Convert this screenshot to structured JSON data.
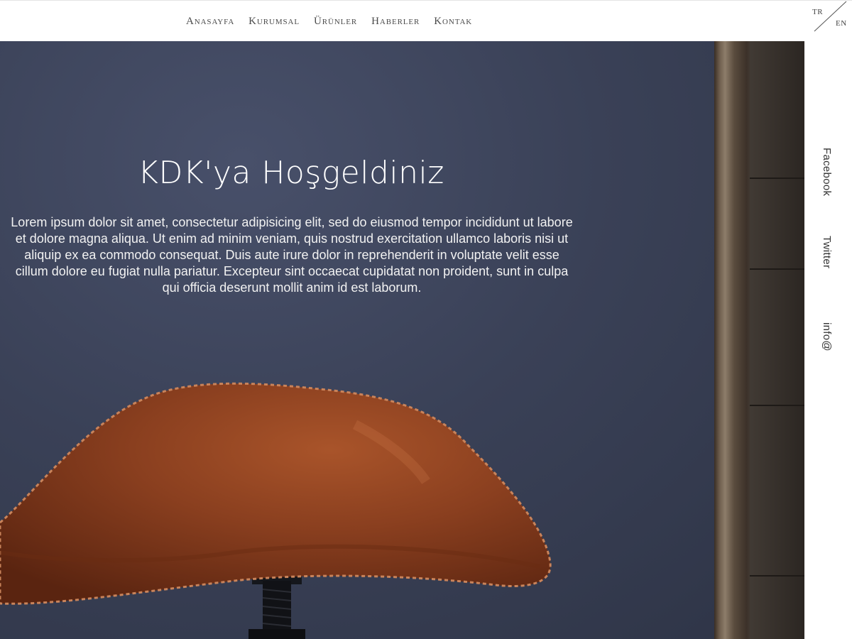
{
  "nav": {
    "items": [
      "Anasayfa",
      "Kurumsal",
      "Ürünler",
      "Haberler",
      "Kontak"
    ]
  },
  "lang": {
    "tr": "TR",
    "en": "EN"
  },
  "hero": {
    "title": "KDK'ya Hoşgeldiniz",
    "text": "Lorem ipsum dolor sit amet, consectetur adipisicing elit, sed do eiusmod tempor incididunt ut labore et dolore magna aliqua. Ut enim ad minim veniam, quis nostrud exercitation ullamco laboris nisi ut aliquip ex ea commodo consequat. Duis aute irure dolor in reprehenderit in voluptate velit esse cillum dolore eu fugiat nulla pariatur. Excepteur sint occaecat cupidatat non proident, sunt in culpa qui officia deserunt mollit anim id est laborum."
  },
  "social": {
    "facebook": "Facebook",
    "twitter": "Twitter",
    "email": "info@"
  },
  "colors": {
    "wall": "#3a4157",
    "leather": "#8a3f1f",
    "nav_text": "#4a4a4a"
  }
}
